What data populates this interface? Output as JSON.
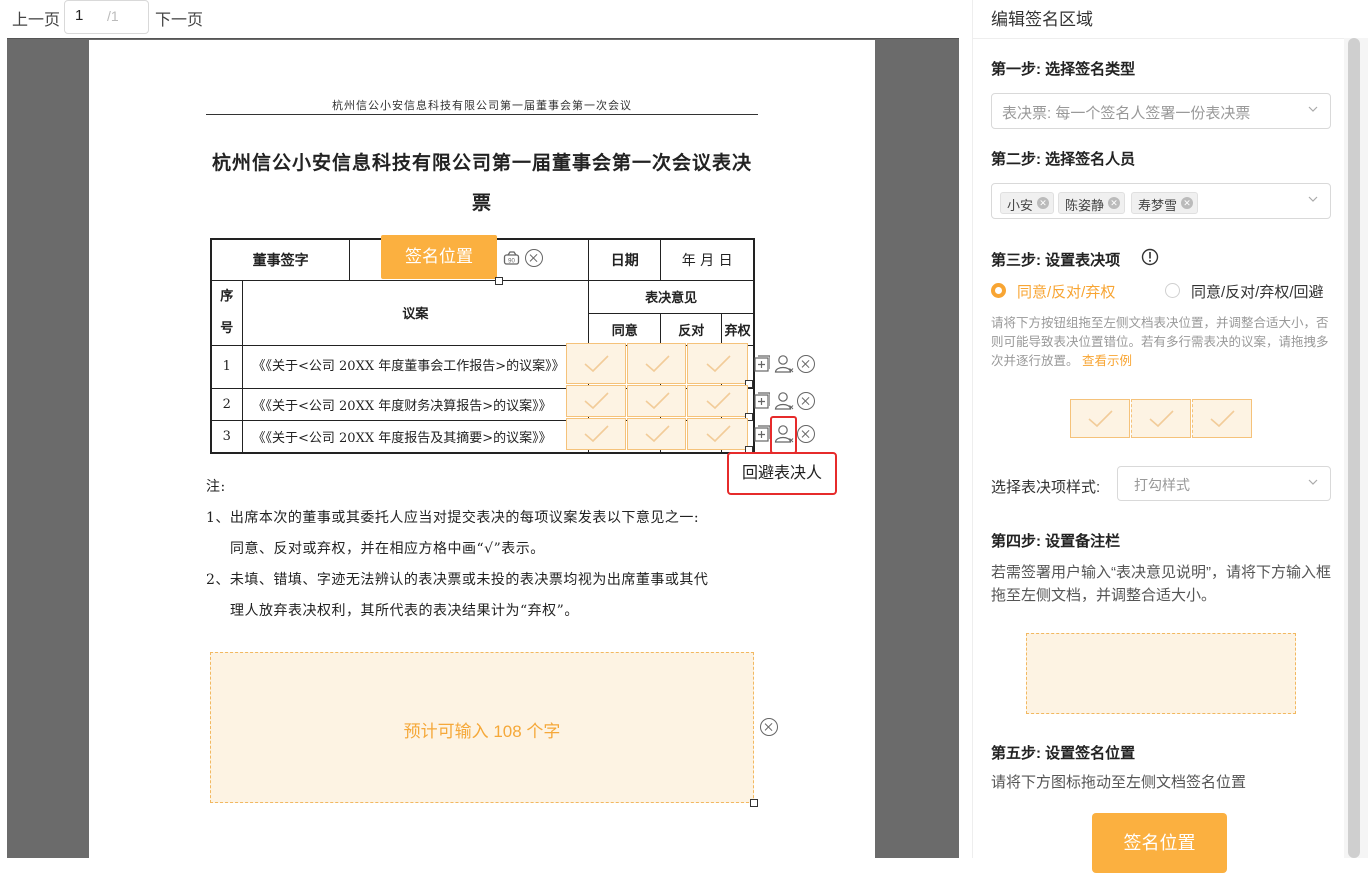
{
  "pager": {
    "prev": "上一页",
    "current_page": "1",
    "total": "/1",
    "next": "下一页"
  },
  "document": {
    "header": "杭州信公小安信息科技有限公司第一届董事会第一次会议",
    "title_line1": "杭州信公小安信息科技有限公司第一届董事会第一次会议表决",
    "title_line2": "票",
    "table": {
      "director_sign": "董事签字",
      "date_label": "日期",
      "date_value": "年    月    日",
      "seq_header": "序号",
      "proposal_header": "议案",
      "opinion_header": "表决意见",
      "opinions": [
        "同意",
        "反对",
        "弃权"
      ],
      "rows": [
        {
          "no": "1",
          "text": "《《关于<公司 20XX 年度董事会工作报告>的议案》》"
        },
        {
          "no": "2",
          "text": "《《关于<公司 20XX 年度财务决算报告>的议案》》"
        },
        {
          "no": "3",
          "text": "《《关于<公司 20XX 年度报告及其摘要>的议案》》"
        }
      ]
    },
    "signature_button": "签名位置",
    "notes": [
      "注:",
      "1、出席本次的董事或其委托人应当对提交表决的每项议案发表以下意见之一:",
      "同意、反对或弃权，并在相应方格中画“√”表示。",
      "2、未填、错填、字迹无法辨认的表决票或未投的表决票均视为出席董事或其代",
      "理人放弃表决权利，其所代表的表决结果计为“弃权”。"
    ],
    "input_placeholder": "预计可输入 108 个字",
    "tooltip": "回避表决人"
  },
  "panel": {
    "title": "编辑签名区域",
    "step1": {
      "label": "第一步: 选择签名类型",
      "value": "表决票: 每一个签名人签署一份表决票"
    },
    "step2": {
      "label": "第二步: 选择签名人员",
      "tags": [
        "小安",
        "陈姿静",
        "寿梦雪"
      ]
    },
    "step3": {
      "label": "第三步: 设置表决项",
      "option1": "同意/反对/弃权",
      "option2": "同意/反对/弃权/回避",
      "hint": "请将下方按钮组拖至左侧文档表决位置，并调整合适大小，否则可能导致表决位置错位。若有多行需表决的议案，请拖拽多次并逐行放置。",
      "hint_link": "查看示例",
      "style_label": "选择表决项样式:",
      "style_value": "打勾样式"
    },
    "step4": {
      "label": "第四步: 设置备注栏",
      "desc": "若需签署用户输入“表决意见说明”，请将下方输入框拖至左侧文档，并调整合适大小。"
    },
    "step5": {
      "label": "第五步: 设置签名位置",
      "desc": "请将下方图标拖动至左侧文档签名位置",
      "button": "签名位置"
    }
  },
  "colors": {
    "accent": "#f8a533",
    "check_bg": "#fdf3e3",
    "check_border": "#f5c27a",
    "viewer_bg": "#6b6b6b",
    "highlight": "#e62b2b"
  },
  "icons": [
    "seal-icon",
    "close-circle-icon",
    "add-square-icon",
    "user-avoid-icon",
    "chevron-down-icon",
    "info-circle-icon",
    "check-icon"
  ]
}
